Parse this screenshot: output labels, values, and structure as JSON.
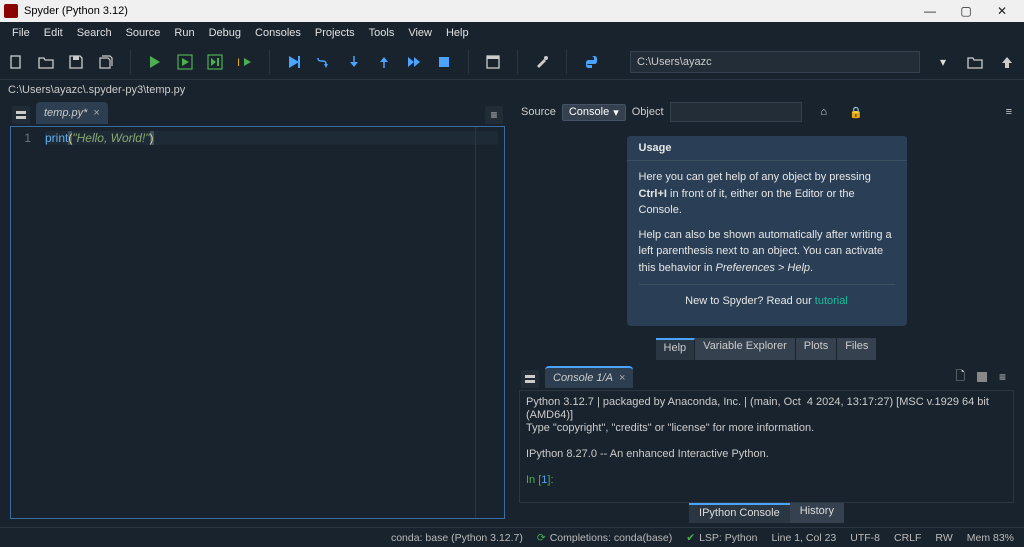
{
  "window": {
    "title": "Spyder (Python 3.12)"
  },
  "menubar": [
    "File",
    "Edit",
    "Search",
    "Source",
    "Run",
    "Debug",
    "Consoles",
    "Projects",
    "Tools",
    "View",
    "Help"
  ],
  "toolbar": {
    "working_dir": "C:\\Users\\ayazc"
  },
  "editor": {
    "path": "C:\\Users\\ayazc\\.spyder-py3\\temp.py",
    "tab_label": "temp.py*",
    "gutter": "1",
    "code_fn": "print",
    "code_str": "\"Hello, World!\""
  },
  "help": {
    "source_label": "Source",
    "source_value": "Console",
    "object_label": "Object",
    "card_title": "Usage",
    "card_p1a": "Here you can get help of any object by pressing ",
    "card_p1b_bold": "Ctrl+I",
    "card_p1c": " in front of it, either on the Editor or the Console.",
    "card_p2a": "Help can also be shown automatically after writing a left parenthesis next to an object. You can activate this behavior in ",
    "card_p2b_italic": "Preferences > Help",
    "card_p2c": ".",
    "card_foot_pre": "New to Spyder? Read our ",
    "card_foot_link": "tutorial",
    "tabs": {
      "help": "Help",
      "varexp": "Variable Explorer",
      "plots": "Plots",
      "files": "Files"
    }
  },
  "console": {
    "tab_label": "Console 1/A",
    "line1": "Python 3.12.7 | packaged by Anaconda, Inc. | (main, Oct  4 2024, 13:17:27) [MSC v.1929 64 bit (AMD64)]",
    "line2": "Type \"copyright\", \"credits\" or \"license\" for more information.",
    "line3": "",
    "line4": "IPython 8.27.0 -- An enhanced Interactive Python.",
    "prompt_in": "In [",
    "prompt_num": "1",
    "prompt_close": "]:",
    "tabs": {
      "ipython": "IPython Console",
      "history": "History"
    }
  },
  "statusbar": {
    "conda": "conda: base (Python 3.12.7)",
    "completions": "Completions: conda(base)",
    "lsp": "LSP: Python",
    "pos": "Line 1, Col 23",
    "enc": "UTF-8",
    "eol": "CRLF",
    "rw": "RW",
    "mem": "Mem 83%"
  }
}
